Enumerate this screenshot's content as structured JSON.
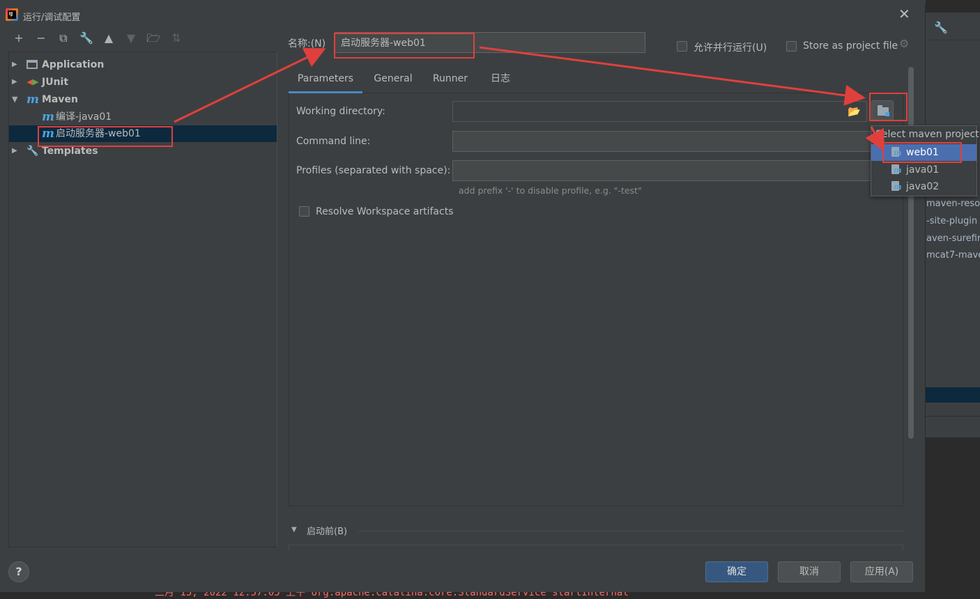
{
  "dialog": {
    "title": "运行/调试配置",
    "close_icon": "close-icon"
  },
  "toolbar": {
    "add": "+",
    "remove": "−",
    "copy": "copy-icon",
    "edit": "wrench-icon",
    "up": "move-up-icon",
    "down": "move-down-icon",
    "folder": "new-folder-icon",
    "sort": "sort-icon"
  },
  "tree": {
    "items": [
      {
        "label": "Application",
        "icon": "application-icon",
        "level": 0,
        "expanded": false
      },
      {
        "label": "JUnit",
        "icon": "junit-icon",
        "level": 0,
        "expanded": false
      },
      {
        "label": "Maven",
        "icon": "maven-icon",
        "level": 0,
        "expanded": true
      },
      {
        "label": "编译-java01",
        "icon": "maven-icon",
        "level": 1
      },
      {
        "label": "启动服务器-web01",
        "icon": "maven-icon",
        "level": 1,
        "selected": true
      },
      {
        "label": "Templates",
        "icon": "wrench-icon",
        "level": 0,
        "expanded": false
      }
    ]
  },
  "form": {
    "name_label": "名称:(N)",
    "name_value": "启动服务器-web01",
    "parallel_label": "允许并行运行(U)",
    "parallel_checked": false,
    "store_label": "Store as project file",
    "store_checked": false,
    "tabs": [
      {
        "label": "Parameters",
        "active": true
      },
      {
        "label": "General",
        "active": false
      },
      {
        "label": "Runner",
        "active": false
      },
      {
        "label": "日志",
        "active": false
      }
    ],
    "working_dir_label": "Working directory:",
    "working_dir_value": "",
    "command_line_label": "Command line:",
    "command_line_value": "",
    "profiles_label": "Profiles (separated with space):",
    "profiles_value": "",
    "profiles_hint": "add prefix '-' to disable profile, e.g. \"-test\"",
    "resolve_label": "Resolve Workspace artifacts",
    "resolve_checked": false,
    "before_launch_label": "启动前(B)"
  },
  "popup": {
    "title": "Select maven project",
    "items": [
      {
        "label": "web01",
        "selected": true
      },
      {
        "label": "java01",
        "selected": false
      },
      {
        "label": "java02",
        "selected": false
      }
    ]
  },
  "buttons": {
    "help": "?",
    "ok": "确定",
    "cancel": "取消",
    "apply": "应用(A)"
  },
  "background": {
    "maven_items": [
      "maven-reso",
      "-site-plugin",
      "aven-surefir",
      "mcat7-mave"
    ],
    "console_text": "三月 15, 2022 12:57:05 上午 org.apache.catalina.core.StandardService startInternal"
  },
  "colors": {
    "accent": "#4a88c7",
    "selection": "#0d293e",
    "popup_selection": "#4b6eaf",
    "annotation_red": "#e0403d",
    "primary_button": "#365880"
  }
}
